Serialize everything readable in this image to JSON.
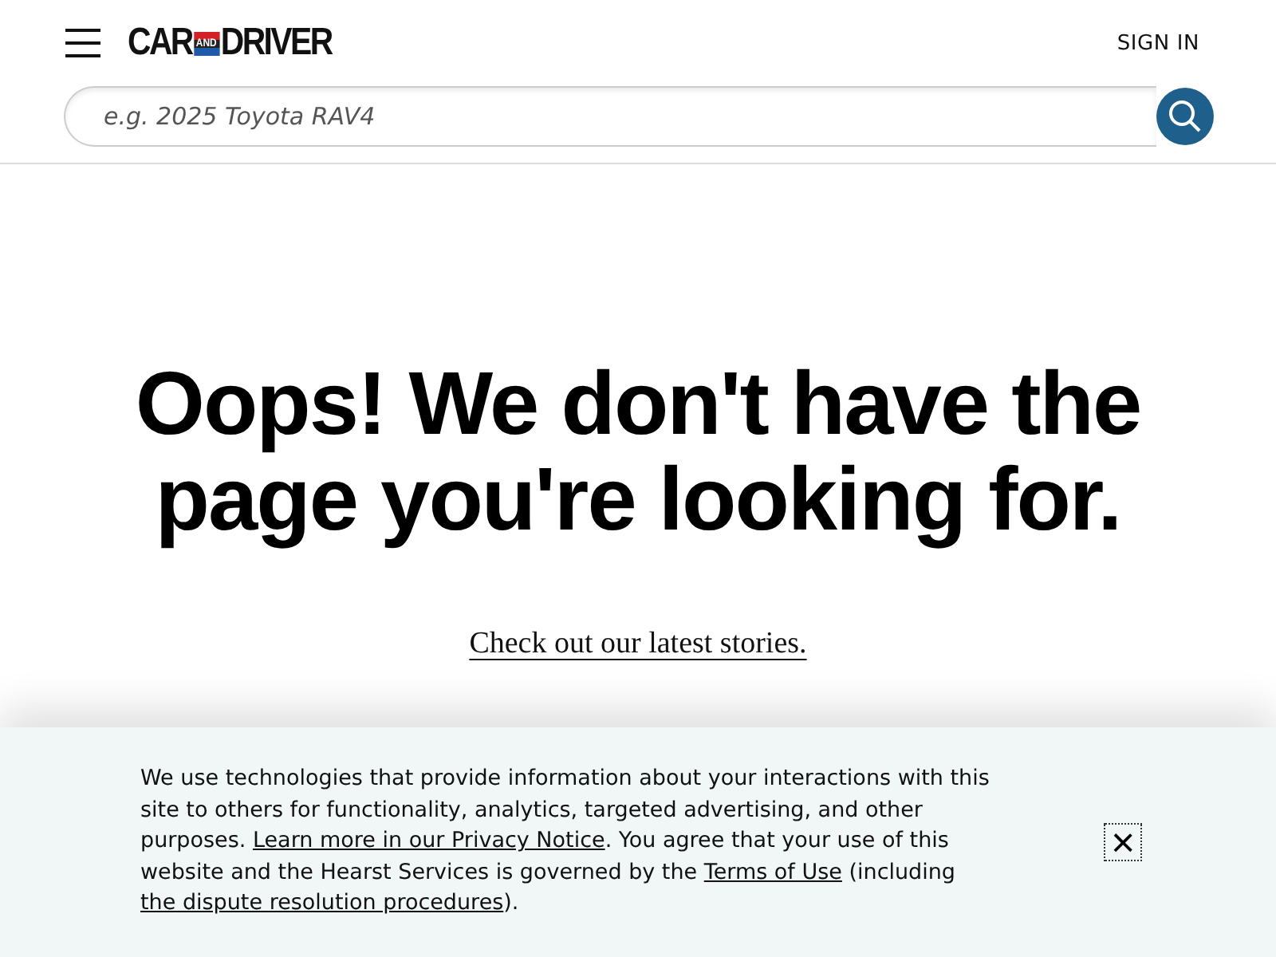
{
  "header": {
    "logo": {
      "left": "CAR",
      "middle": "AND",
      "right": "DRIVER"
    },
    "sign_in": "SIGN IN"
  },
  "search": {
    "placeholder": "e.g. 2025 Toyota RAV4"
  },
  "error": {
    "heading": "Oops! We don't have the page you're looking for.",
    "link": "Check out our latest stories."
  },
  "notice": {
    "segments": [
      {
        "kind": "text",
        "text": "We use technologies that provide information about your interactions with this site to others for functionality, analytics, targeted advertising, and other purposes. "
      },
      {
        "kind": "link",
        "text": "Learn more in our Privacy Notice"
      },
      {
        "kind": "text",
        "text": ". You agree that your use of this website and the Hearst Services is governed by the "
      },
      {
        "kind": "link",
        "text": "Terms of Use"
      },
      {
        "kind": "text",
        "text": " (including "
      },
      {
        "kind": "link",
        "text": "the dispute resolution procedures"
      },
      {
        "kind": "text",
        "text": ")."
      }
    ],
    "close": "×"
  }
}
